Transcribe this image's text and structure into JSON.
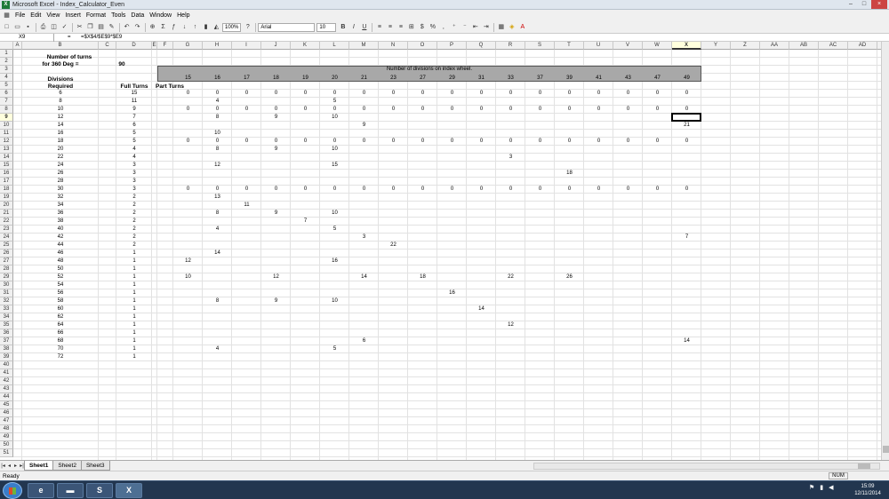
{
  "window": {
    "title": "Microsoft Excel - Index_Calculator_Even",
    "app_icon": "excel-icon",
    "minimize": "–",
    "maximize": "□",
    "close": "×"
  },
  "menu": {
    "items": [
      "File",
      "Edit",
      "View",
      "Insert",
      "Format",
      "Tools",
      "Data",
      "Window",
      "Help"
    ],
    "help_box": "Type a question for help"
  },
  "toolbar": {
    "zoom": "100%",
    "font": "Arial",
    "size": "10",
    "bold": "B",
    "italic": "I",
    "underline": "U"
  },
  "formula_bar": {
    "name_box": "X9",
    "eq": "=",
    "formula": "=$X$4/$E$9*$E9"
  },
  "columns": [
    "A",
    "B",
    "C",
    "D",
    "E",
    "F",
    "G",
    "H",
    "I",
    "J",
    "K",
    "L",
    "M",
    "N",
    "O",
    "P",
    "Q",
    "R",
    "S",
    "T",
    "U",
    "V",
    "W",
    "X",
    "Y",
    "Z",
    "AA",
    "AB",
    "AC",
    "AD",
    "AE",
    "AF"
  ],
  "rows": [
    "1",
    "2",
    "3",
    "4",
    "5",
    "6",
    "7",
    "8",
    "9",
    "10",
    "11",
    "12",
    "13",
    "14",
    "15",
    "16",
    "17",
    "18",
    "19",
    "20",
    "21",
    "22",
    "23",
    "24",
    "25",
    "26",
    "27",
    "28",
    "29",
    "30",
    "31",
    "32",
    "33",
    "34",
    "35",
    "36",
    "37",
    "38",
    "39",
    "40",
    "41",
    "42",
    "43",
    "44",
    "45",
    "46",
    "47",
    "48",
    "49",
    "50",
    "51"
  ],
  "sheet": {
    "title_label": "Number of turns",
    "title_label2": "for 360 Deg =",
    "turns_value": "90",
    "band_label": "Number of divisions on index wheel.",
    "divisions_label": "Divisions",
    "required_label": "Required",
    "full_turns_label": "Full Turns",
    "part_turns_label": "Part Turns",
    "wheels": [
      "15",
      "16",
      "17",
      "18",
      "19",
      "20",
      "21",
      "23",
      "27",
      "29",
      "31",
      "33",
      "37",
      "39",
      "41",
      "43",
      "47",
      "49"
    ],
    "divisions": [
      "6",
      "8",
      "10",
      "12",
      "14",
      "16",
      "18",
      "20",
      "22",
      "24",
      "26",
      "28",
      "30",
      "32",
      "34",
      "36",
      "38",
      "40",
      "42",
      "44",
      "46",
      "48",
      "50",
      "52",
      "54",
      "56",
      "58",
      "60",
      "62",
      "64",
      "66",
      "68",
      "70",
      "72"
    ],
    "full_turns": [
      "15",
      "11",
      "9",
      "7",
      "6",
      "5",
      "5",
      "4",
      "4",
      "3",
      "3",
      "3",
      "3",
      "2",
      "2",
      "2",
      "2",
      "2",
      "2",
      "2",
      "1",
      "1",
      "1",
      "1",
      "1",
      "1",
      "1",
      "1",
      "1",
      "1",
      "1",
      "1",
      "1",
      "1"
    ],
    "part_turns": [
      {
        "r": 0,
        "c": 0,
        "v": "0"
      },
      {
        "r": 0,
        "c": 1,
        "v": "0"
      },
      {
        "r": 0,
        "c": 2,
        "v": "0"
      },
      {
        "r": 0,
        "c": 3,
        "v": "0"
      },
      {
        "r": 0,
        "c": 4,
        "v": "0"
      },
      {
        "r": 0,
        "c": 5,
        "v": "0"
      },
      {
        "r": 0,
        "c": 6,
        "v": "0"
      },
      {
        "r": 0,
        "c": 7,
        "v": "0"
      },
      {
        "r": 0,
        "c": 8,
        "v": "0"
      },
      {
        "r": 0,
        "c": 9,
        "v": "0"
      },
      {
        "r": 0,
        "c": 10,
        "v": "0"
      },
      {
        "r": 0,
        "c": 11,
        "v": "0"
      },
      {
        "r": 0,
        "c": 12,
        "v": "0"
      },
      {
        "r": 0,
        "c": 13,
        "v": "0"
      },
      {
        "r": 0,
        "c": 14,
        "v": "0"
      },
      {
        "r": 0,
        "c": 15,
        "v": "0"
      },
      {
        "r": 0,
        "c": 16,
        "v": "0"
      },
      {
        "r": 0,
        "c": 17,
        "v": "0"
      },
      {
        "r": 1,
        "c": 1,
        "v": "4"
      },
      {
        "r": 1,
        "c": 5,
        "v": "5"
      },
      {
        "r": 2,
        "c": 0,
        "v": "0"
      },
      {
        "r": 2,
        "c": 1,
        "v": "0"
      },
      {
        "r": 2,
        "c": 2,
        "v": "0"
      },
      {
        "r": 2,
        "c": 3,
        "v": "0"
      },
      {
        "r": 2,
        "c": 4,
        "v": "0"
      },
      {
        "r": 2,
        "c": 5,
        "v": "0"
      },
      {
        "r": 2,
        "c": 6,
        "v": "0"
      },
      {
        "r": 2,
        "c": 7,
        "v": "0"
      },
      {
        "r": 2,
        "c": 8,
        "v": "0"
      },
      {
        "r": 2,
        "c": 9,
        "v": "0"
      },
      {
        "r": 2,
        "c": 10,
        "v": "0"
      },
      {
        "r": 2,
        "c": 11,
        "v": "0"
      },
      {
        "r": 2,
        "c": 12,
        "v": "0"
      },
      {
        "r": 2,
        "c": 13,
        "v": "0"
      },
      {
        "r": 2,
        "c": 14,
        "v": "0"
      },
      {
        "r": 2,
        "c": 15,
        "v": "0"
      },
      {
        "r": 2,
        "c": 16,
        "v": "0"
      },
      {
        "r": 2,
        "c": 17,
        "v": "0"
      },
      {
        "r": 3,
        "c": 1,
        "v": "8"
      },
      {
        "r": 3,
        "c": 3,
        "v": "9"
      },
      {
        "r": 3,
        "c": 5,
        "v": "10"
      },
      {
        "r": 4,
        "c": 6,
        "v": "9"
      },
      {
        "r": 4,
        "c": 17,
        "v": "21"
      },
      {
        "r": 5,
        "c": 1,
        "v": "10"
      },
      {
        "r": 6,
        "c": 0,
        "v": "0"
      },
      {
        "r": 6,
        "c": 1,
        "v": "0"
      },
      {
        "r": 6,
        "c": 2,
        "v": "0"
      },
      {
        "r": 6,
        "c": 3,
        "v": "0"
      },
      {
        "r": 6,
        "c": 4,
        "v": "0"
      },
      {
        "r": 6,
        "c": 5,
        "v": "0"
      },
      {
        "r": 6,
        "c": 6,
        "v": "0"
      },
      {
        "r": 6,
        "c": 7,
        "v": "0"
      },
      {
        "r": 6,
        "c": 8,
        "v": "0"
      },
      {
        "r": 6,
        "c": 9,
        "v": "0"
      },
      {
        "r": 6,
        "c": 10,
        "v": "0"
      },
      {
        "r": 6,
        "c": 11,
        "v": "0"
      },
      {
        "r": 6,
        "c": 12,
        "v": "0"
      },
      {
        "r": 6,
        "c": 13,
        "v": "0"
      },
      {
        "r": 6,
        "c": 14,
        "v": "0"
      },
      {
        "r": 6,
        "c": 15,
        "v": "0"
      },
      {
        "r": 6,
        "c": 16,
        "v": "0"
      },
      {
        "r": 6,
        "c": 17,
        "v": "0"
      },
      {
        "r": 7,
        "c": 1,
        "v": "8"
      },
      {
        "r": 7,
        "c": 3,
        "v": "9"
      },
      {
        "r": 7,
        "c": 5,
        "v": "10"
      },
      {
        "r": 8,
        "c": 11,
        "v": "3"
      },
      {
        "r": 9,
        "c": 1,
        "v": "12"
      },
      {
        "r": 9,
        "c": 5,
        "v": "15"
      },
      {
        "r": 10,
        "c": 13,
        "v": "18"
      },
      {
        "r": 12,
        "c": 0,
        "v": "0"
      },
      {
        "r": 12,
        "c": 1,
        "v": "0"
      },
      {
        "r": 12,
        "c": 2,
        "v": "0"
      },
      {
        "r": 12,
        "c": 3,
        "v": "0"
      },
      {
        "r": 12,
        "c": 4,
        "v": "0"
      },
      {
        "r": 12,
        "c": 5,
        "v": "0"
      },
      {
        "r": 12,
        "c": 6,
        "v": "0"
      },
      {
        "r": 12,
        "c": 7,
        "v": "0"
      },
      {
        "r": 12,
        "c": 8,
        "v": "0"
      },
      {
        "r": 12,
        "c": 9,
        "v": "0"
      },
      {
        "r": 12,
        "c": 10,
        "v": "0"
      },
      {
        "r": 12,
        "c": 11,
        "v": "0"
      },
      {
        "r": 12,
        "c": 12,
        "v": "0"
      },
      {
        "r": 12,
        "c": 13,
        "v": "0"
      },
      {
        "r": 12,
        "c": 14,
        "v": "0"
      },
      {
        "r": 12,
        "c": 15,
        "v": "0"
      },
      {
        "r": 12,
        "c": 16,
        "v": "0"
      },
      {
        "r": 12,
        "c": 17,
        "v": "0"
      },
      {
        "r": 13,
        "c": 1,
        "v": "13"
      },
      {
        "r": 14,
        "c": 2,
        "v": "11"
      },
      {
        "r": 15,
        "c": 1,
        "v": "8"
      },
      {
        "r": 15,
        "c": 3,
        "v": "9"
      },
      {
        "r": 15,
        "c": 5,
        "v": "10"
      },
      {
        "r": 16,
        "c": 4,
        "v": "7"
      },
      {
        "r": 17,
        "c": 1,
        "v": "4"
      },
      {
        "r": 17,
        "c": 5,
        "v": "5"
      },
      {
        "r": 18,
        "c": 6,
        "v": "3"
      },
      {
        "r": 18,
        "c": 17,
        "v": "7"
      },
      {
        "r": 19,
        "c": 7,
        "v": "22"
      },
      {
        "r": 20,
        "c": 1,
        "v": "14"
      },
      {
        "r": 21,
        "c": 0,
        "v": "12"
      },
      {
        "r": 21,
        "c": 5,
        "v": "16"
      },
      {
        "r": 23,
        "c": 0,
        "v": "10"
      },
      {
        "r": 23,
        "c": 3,
        "v": "12"
      },
      {
        "r": 23,
        "c": 6,
        "v": "14"
      },
      {
        "r": 23,
        "c": 8,
        "v": "18"
      },
      {
        "r": 23,
        "c": 11,
        "v": "22"
      },
      {
        "r": 23,
        "c": 13,
        "v": "26"
      },
      {
        "r": 25,
        "c": 9,
        "v": "16"
      },
      {
        "r": 26,
        "c": 1,
        "v": "8"
      },
      {
        "r": 26,
        "c": 3,
        "v": "9"
      },
      {
        "r": 26,
        "c": 5,
        "v": "10"
      },
      {
        "r": 27,
        "c": 10,
        "v": "14"
      },
      {
        "r": 29,
        "c": 11,
        "v": "12"
      },
      {
        "r": 31,
        "c": 6,
        "v": "6"
      },
      {
        "r": 31,
        "c": 17,
        "v": "14"
      },
      {
        "r": 32,
        "c": 1,
        "v": "4"
      },
      {
        "r": 32,
        "c": 5,
        "v": "5"
      }
    ]
  },
  "tabs": [
    "Sheet1",
    "Sheet2",
    "Sheet3"
  ],
  "status": {
    "text": "Ready",
    "num": "NUM"
  },
  "taskbar": {
    "time": "15:09",
    "date": "12/11/2014"
  }
}
